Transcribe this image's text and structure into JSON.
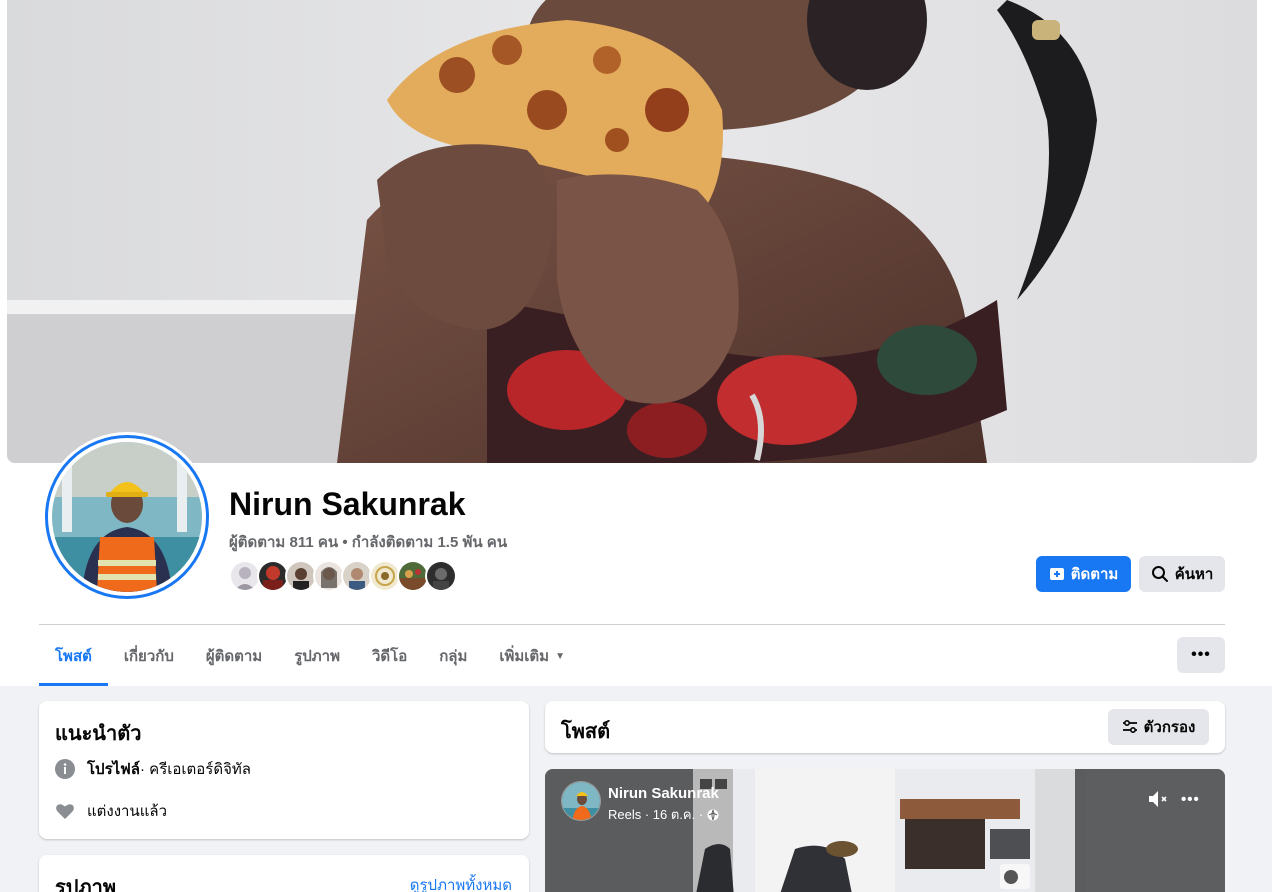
{
  "profile": {
    "name": "Nirun Sakunrak",
    "stats": "ผู้ติดตาม 811 คน • กำลังติดตาม 1.5 พัน คน",
    "follow_label": "ติดตาม",
    "search_label": "ค้นหา"
  },
  "tabs": [
    {
      "label": "โพสต์",
      "active": true
    },
    {
      "label": "เกี่ยวกับ"
    },
    {
      "label": "ผู้ติดตาม"
    },
    {
      "label": "รูปภาพ"
    },
    {
      "label": "วิดีโอ"
    },
    {
      "label": "กลุ่ม"
    },
    {
      "label": "เพิ่มเติม"
    }
  ],
  "more_button": "•••",
  "intro": {
    "title": "แนะนำตัว",
    "profile_label": "โปรไฟล์",
    "profile_detail": " · ครีเอเตอร์ดิจิทัล",
    "relationship": "แต่งงานแล้ว"
  },
  "photos": {
    "title": "รูปภาพ",
    "see_all": "ดูรูปภาพทั้งหมด"
  },
  "posts": {
    "title": "โพสต์",
    "filter_label": "ตัวกรอง"
  },
  "reel": {
    "author": "Nirun Sakunrak",
    "meta": "Reels · 16 ต.ค. ·",
    "more": "•••"
  },
  "colors": {
    "accent": "#1877f2",
    "page_bg": "#f0f2f5",
    "secondary_button": "#e4e6eb"
  }
}
